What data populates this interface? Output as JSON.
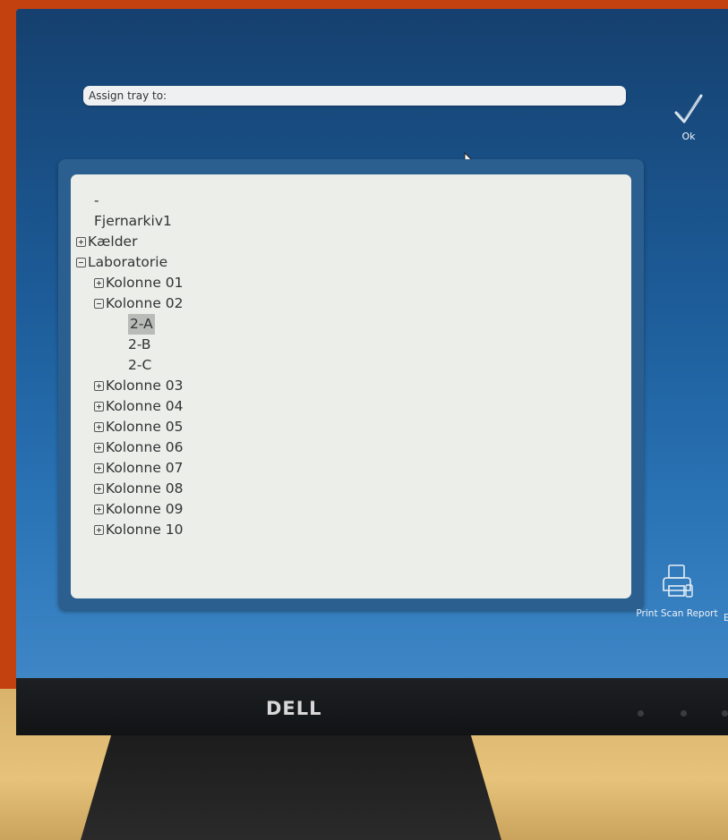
{
  "assign": {
    "placeholder": "Assign tray to:"
  },
  "ok": {
    "label": "Ok",
    "icon": "checkmark-icon"
  },
  "tree": {
    "items": [
      {
        "label": "-",
        "level": 0,
        "toggle": "none"
      },
      {
        "label": "Fjernarkiv1",
        "level": 0,
        "toggle": "none"
      },
      {
        "label": "Kælder",
        "level": 0,
        "toggle": "plus"
      },
      {
        "label": "Laboratorie",
        "level": 0,
        "toggle": "minus"
      },
      {
        "label": "Kolonne 01",
        "level": 1,
        "toggle": "plus"
      },
      {
        "label": "Kolonne 02",
        "level": 1,
        "toggle": "minus"
      },
      {
        "label": "2-A",
        "level": 2,
        "toggle": "none",
        "selected": true
      },
      {
        "label": "2-B",
        "level": 2,
        "toggle": "none"
      },
      {
        "label": "2-C",
        "level": 2,
        "toggle": "none"
      },
      {
        "label": "Kolonne 03",
        "level": 1,
        "toggle": "plus"
      },
      {
        "label": "Kolonne 04",
        "level": 1,
        "toggle": "plus"
      },
      {
        "label": "Kolonne 05",
        "level": 1,
        "toggle": "plus"
      },
      {
        "label": "Kolonne 06",
        "level": 1,
        "toggle": "plus"
      },
      {
        "label": "Kolonne 07",
        "level": 1,
        "toggle": "plus"
      },
      {
        "label": "Kolonne 08",
        "level": 1,
        "toggle": "plus"
      },
      {
        "label": "Kolonne 09",
        "level": 1,
        "toggle": "plus"
      },
      {
        "label": "Kolonne 10",
        "level": 1,
        "toggle": "plus"
      }
    ]
  },
  "print": {
    "label": "Print Scan Report",
    "icon": "printer-icon"
  },
  "edge_button": {
    "label": "E"
  },
  "monitor": {
    "brand": "DELL"
  },
  "colors": {
    "screen_bg": "#1d5d9a",
    "panel_bg": "#eceeea",
    "frame": "#2b5f8f",
    "selection": "#b9bbb8"
  }
}
